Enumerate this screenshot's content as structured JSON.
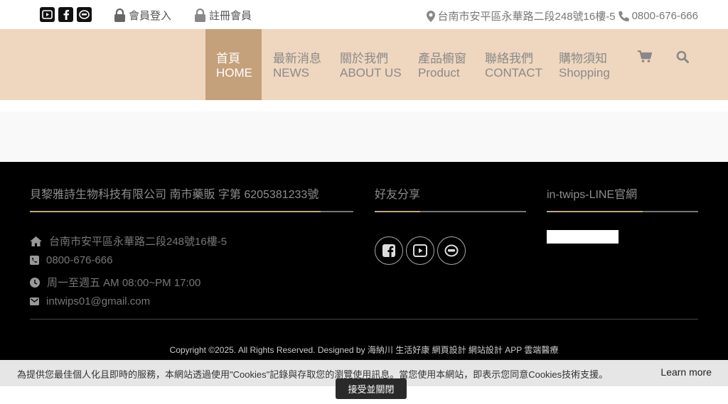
{
  "topbar": {
    "social": [
      "youtube-icon",
      "facebook-icon",
      "line-icon"
    ],
    "login": "會員登入",
    "register": "註冊會員",
    "address": "台南市安平區永華路二段248號16樓-5",
    "phone": "0800-676-666"
  },
  "nav": {
    "items": [
      {
        "zh": "首頁",
        "en": "HOME"
      },
      {
        "zh": "最新消息",
        "en": "NEWS"
      },
      {
        "zh": "關於我們",
        "en": "ABOUT US"
      },
      {
        "zh": "產品櫥窗",
        "en": "Product"
      },
      {
        "zh": "聯絡我們",
        "en": "CONTACT"
      },
      {
        "zh": "購物須知",
        "en": "Shopping"
      }
    ],
    "icons": [
      "cart-icon",
      "search-icon"
    ]
  },
  "footer": {
    "company": "貝黎雅詩生物科技有限公司 南市藥販 字第 6205381233號",
    "share_title": "好友分享",
    "line_title": "in-twips-LINE官網",
    "address": "台南市安平區永華路二段248號16樓-5",
    "phone": "0800-676-666",
    "hours": "周一至週五 AM 08:00~PM 17:00",
    "email": "intwips01@gmail.com",
    "copyright": "Copyright ©2025. All Rights Reserved. Designed by 海納川 生活好康 網頁設計 網站設計 APP 雲端醫療"
  },
  "cookie": {
    "text": "為提供您最佳個人化且即時的服務，本網站透過使用\"Cookies\"記錄與存取您的瀏覽使用訊息。當您使用本網站，即表示您同意Cookies技術支援。",
    "learn": "Learn more",
    "accept": "接受並關閉"
  },
  "colors": {
    "nav_bg": "#efd6bf",
    "nav_active": "#c4a07b",
    "accent": "#c9a47d"
  }
}
